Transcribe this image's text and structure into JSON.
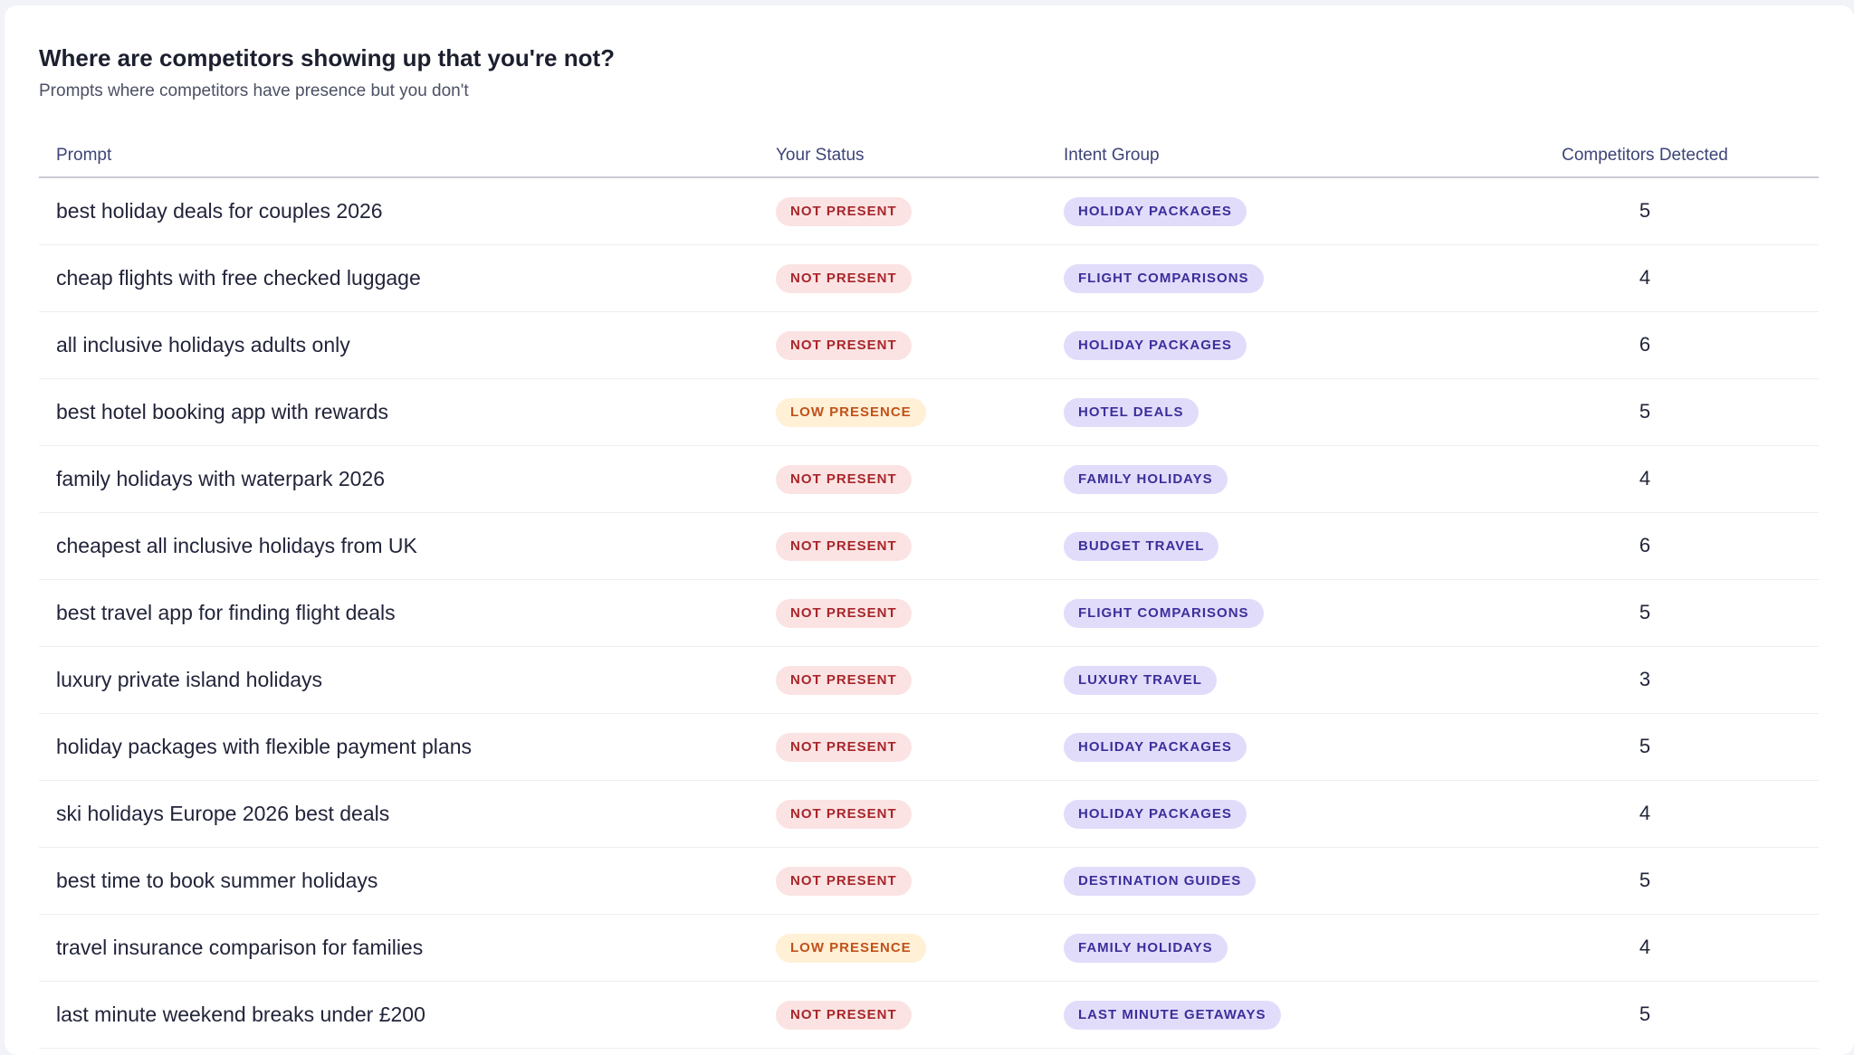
{
  "header": {
    "title": "Where are competitors showing up that you're not?",
    "subtitle": "Prompts where competitors have presence but you don't"
  },
  "table": {
    "columns": [
      "Prompt",
      "Your Status",
      "Intent Group",
      "Competitors Detected"
    ],
    "rows": [
      {
        "prompt": "best holiday deals for couples 2026",
        "status": "NOT PRESENT",
        "status_kind": "not",
        "intent": "HOLIDAY PACKAGES",
        "count": "5"
      },
      {
        "prompt": "cheap flights with free checked luggage",
        "status": "NOT PRESENT",
        "status_kind": "not",
        "intent": "FLIGHT COMPARISONS",
        "count": "4"
      },
      {
        "prompt": "all inclusive holidays adults only",
        "status": "NOT PRESENT",
        "status_kind": "not",
        "intent": "HOLIDAY PACKAGES",
        "count": "6"
      },
      {
        "prompt": "best hotel booking app with rewards",
        "status": "LOW PRESENCE",
        "status_kind": "low",
        "intent": "HOTEL DEALS",
        "count": "5"
      },
      {
        "prompt": "family holidays with waterpark 2026",
        "status": "NOT PRESENT",
        "status_kind": "not",
        "intent": "FAMILY HOLIDAYS",
        "count": "4"
      },
      {
        "prompt": "cheapest all inclusive holidays from UK",
        "status": "NOT PRESENT",
        "status_kind": "not",
        "intent": "BUDGET TRAVEL",
        "count": "6"
      },
      {
        "prompt": "best travel app for finding flight deals",
        "status": "NOT PRESENT",
        "status_kind": "not",
        "intent": "FLIGHT COMPARISONS",
        "count": "5"
      },
      {
        "prompt": "luxury private island holidays",
        "status": "NOT PRESENT",
        "status_kind": "not",
        "intent": "LUXURY TRAVEL",
        "count": "3"
      },
      {
        "prompt": "holiday packages with flexible payment plans",
        "status": "NOT PRESENT",
        "status_kind": "not",
        "intent": "HOLIDAY PACKAGES",
        "count": "5"
      },
      {
        "prompt": "ski holidays Europe 2026 best deals",
        "status": "NOT PRESENT",
        "status_kind": "not",
        "intent": "HOLIDAY PACKAGES",
        "count": "4"
      },
      {
        "prompt": "best time to book summer holidays",
        "status": "NOT PRESENT",
        "status_kind": "not",
        "intent": "DESTINATION GUIDES",
        "count": "5"
      },
      {
        "prompt": "travel insurance comparison for families",
        "status": "LOW PRESENCE",
        "status_kind": "low",
        "intent": "FAMILY HOLIDAYS",
        "count": "4"
      },
      {
        "prompt": "last minute weekend breaks under £200",
        "status": "NOT PRESENT",
        "status_kind": "not",
        "intent": "LAST MINUTE GETAWAYS",
        "count": "5"
      }
    ]
  },
  "colors": {
    "not_present_bg": "#fbe3e3",
    "not_present_text": "#a8262b",
    "low_presence_bg": "#fff0d6",
    "low_presence_text": "#c2511a",
    "intent_bg": "#e2dcfb",
    "intent_text": "#3a2f9a"
  }
}
